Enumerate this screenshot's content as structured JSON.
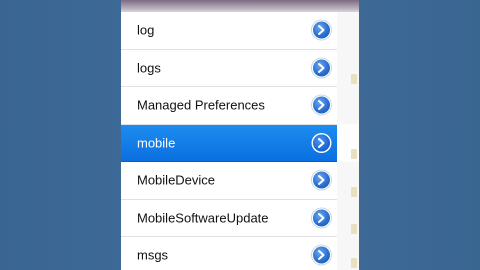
{
  "folder_list": {
    "items": [
      {
        "label": "log",
        "selected": false
      },
      {
        "label": "logs",
        "selected": false
      },
      {
        "label": "Managed Preferences",
        "selected": false
      },
      {
        "label": "mobile",
        "selected": true
      },
      {
        "label": "MobileDevice",
        "selected": false
      },
      {
        "label": "MobileSoftwareUpdate",
        "selected": false
      },
      {
        "label": "msgs",
        "selected": false
      }
    ],
    "disclosure_icon": "chevron-right-circle-icon"
  },
  "colors": {
    "background": "#3d6796",
    "selection": "#1a82ee",
    "disclosure": "#2a6fd0"
  }
}
